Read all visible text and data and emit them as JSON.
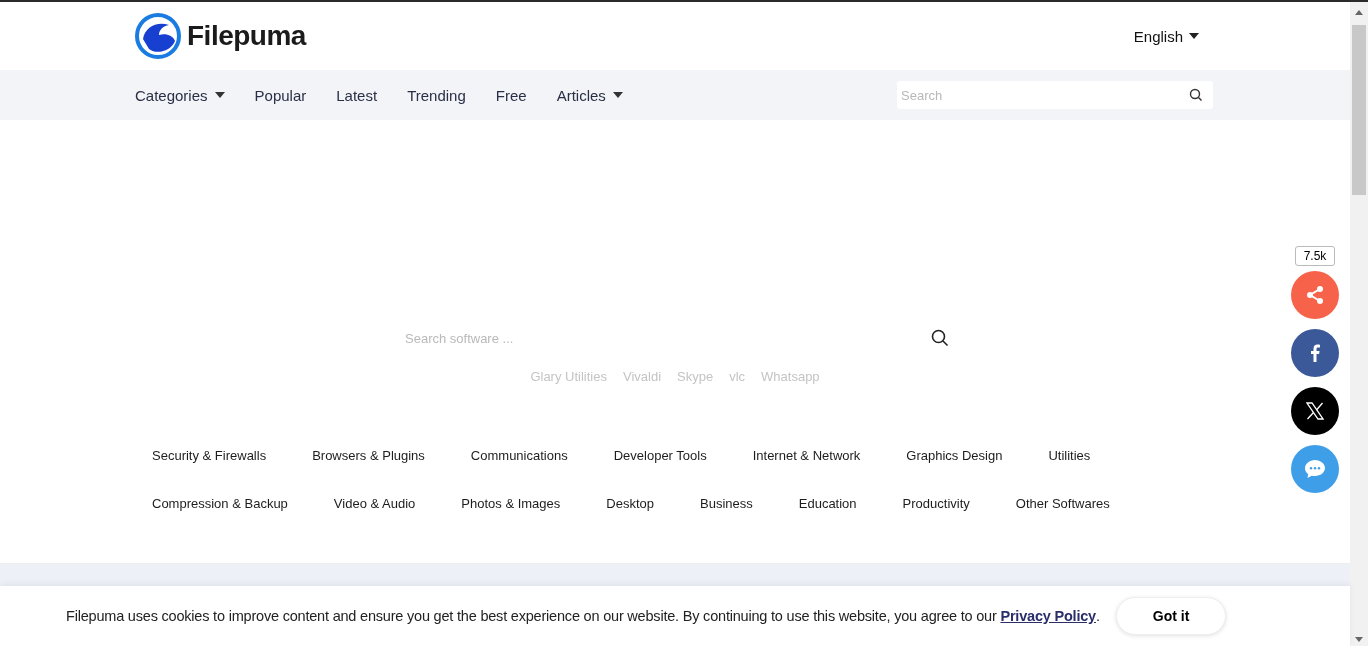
{
  "header": {
    "logo_text": "Filepuma",
    "language": "English"
  },
  "nav": {
    "items": [
      {
        "label": "Categories",
        "dropdown": true
      },
      {
        "label": "Popular",
        "dropdown": false
      },
      {
        "label": "Latest",
        "dropdown": false
      },
      {
        "label": "Trending",
        "dropdown": false
      },
      {
        "label": "Free",
        "dropdown": false
      },
      {
        "label": "Articles",
        "dropdown": true
      }
    ],
    "search": {
      "placeholder": "Search"
    }
  },
  "hero": {
    "search": {
      "placeholder": "Search software ..."
    },
    "quick_links": [
      "Glary Utilities",
      "Vivaldi",
      "Skype",
      "vlc",
      "Whatsapp"
    ]
  },
  "categories": [
    [
      "Security & Firewalls",
      "Browsers & Plugins",
      "Communications",
      "Developer Tools",
      "Internet & Network",
      "Graphics Design",
      "Utilities"
    ],
    [
      "Compression & Backup",
      "Video & Audio",
      "Photos & Images",
      "Desktop",
      "Business",
      "Education",
      "Productivity",
      "Other Softwares"
    ]
  ],
  "share": {
    "count": "7.5k",
    "buttons": [
      {
        "kind": "share",
        "color": "#f7634a"
      },
      {
        "kind": "facebook",
        "color": "#3b5998"
      },
      {
        "kind": "x",
        "color": "#000000"
      },
      {
        "kind": "chat",
        "color": "#3f9ee8"
      }
    ]
  },
  "cookie": {
    "text": "Filepuma uses cookies to improve content and ensure you get the best experience on our website. By continuing to use this website, you agree to our",
    "link": "Privacy Policy",
    "after": ".",
    "button": "Got it"
  }
}
